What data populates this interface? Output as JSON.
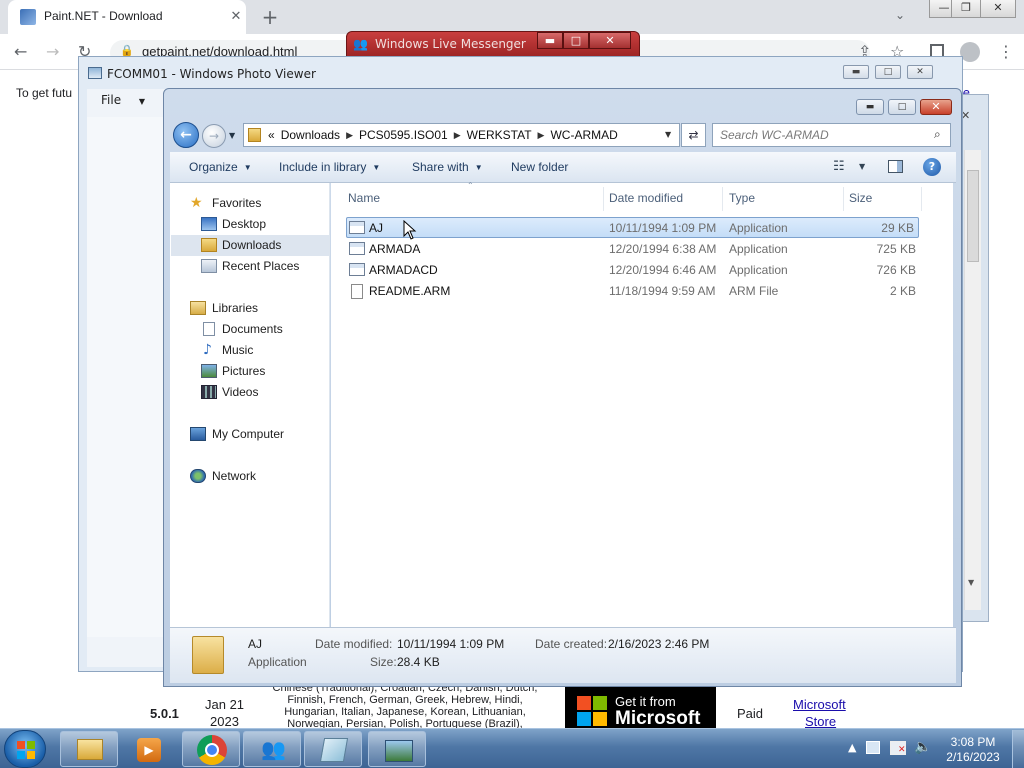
{
  "browser": {
    "tab_title": "Paint.NET - Download",
    "tab_close": "✕",
    "new_tab": "+",
    "url": "getpaint.net/download.html",
    "notice_text": "To get futu",
    "notice_more": "re",
    "window_min": "—",
    "window_max": "❐",
    "window_close": "✕",
    "tab_search": "⌄"
  },
  "messenger": {
    "title": "Windows Live Messenger",
    "min": "▬",
    "max": "□",
    "close": "✕"
  },
  "photo_viewer": {
    "title": "FCOMM01 - Windows Photo Viewer",
    "file_menu": "File",
    "min": "▬",
    "max": "□",
    "close": "✕"
  },
  "explorer": {
    "breadcrumb_prefix": "«",
    "breadcrumbs": [
      "Downloads",
      "PCS0595.ISO01",
      "WERKSTAT",
      "WC-ARMAD"
    ],
    "search_placeholder": "Search WC-ARMAD",
    "commands": {
      "organize": "Organize",
      "include": "Include in library",
      "share": "Share with",
      "new_folder": "New folder"
    },
    "help": "?",
    "nav": {
      "favorites": "Favorites",
      "desktop": "Desktop",
      "downloads": "Downloads",
      "recent": "Recent Places",
      "libraries": "Libraries",
      "documents": "Documents",
      "music": "Music",
      "pictures": "Pictures",
      "videos": "Videos",
      "computer": "My Computer",
      "network": "Network"
    },
    "columns": {
      "name": "Name",
      "date": "Date modified",
      "type": "Type",
      "size": "Size"
    },
    "files": [
      {
        "name": "AJ",
        "date": "10/11/1994 1:09 PM",
        "type": "Application",
        "size": "29 KB"
      },
      {
        "name": "ARMADA",
        "date": "12/20/1994 6:38 AM",
        "type": "Application",
        "size": "725 KB"
      },
      {
        "name": "ARMADACD",
        "date": "12/20/1994 6:46 AM",
        "type": "Application",
        "size": "726 KB"
      },
      {
        "name": "README.ARM",
        "date": "11/18/1994 9:59 AM",
        "type": "ARM File",
        "size": "2 KB"
      }
    ],
    "details": {
      "name": "AJ",
      "kind": "Application",
      "modified_label": "Date modified:",
      "modified_value": "10/11/1994 1:09 PM",
      "created_label": "Date created:",
      "created_value": "2/16/2023 2:46 PM",
      "size_label": "Size:",
      "size_value": "28.4 KB"
    }
  },
  "webpage": {
    "version": "5.0.1",
    "date_line1": "Jan 21",
    "date_line2": "2023",
    "languages_line1": "Chinese (Traditional), Croatian, Czech, Danish, Dutch,",
    "languages_line2": "Finnish, French, German, Greek, Hebrew, Hindi,",
    "languages_line3": "Hungarian, Italian, Japanese, Korean, Lithuanian,",
    "languages_line4": "Norwegian, Persian, Polish, Portuguese (Brazil),",
    "store_line1": "Get it from",
    "store_line2": "Microsoft",
    "price": "Paid",
    "store_link1": "Microsoft",
    "store_link2": "Store"
  },
  "taskbar": {
    "time": "3:08 PM",
    "date": "2/16/2023",
    "tray_arrow": "▲"
  }
}
